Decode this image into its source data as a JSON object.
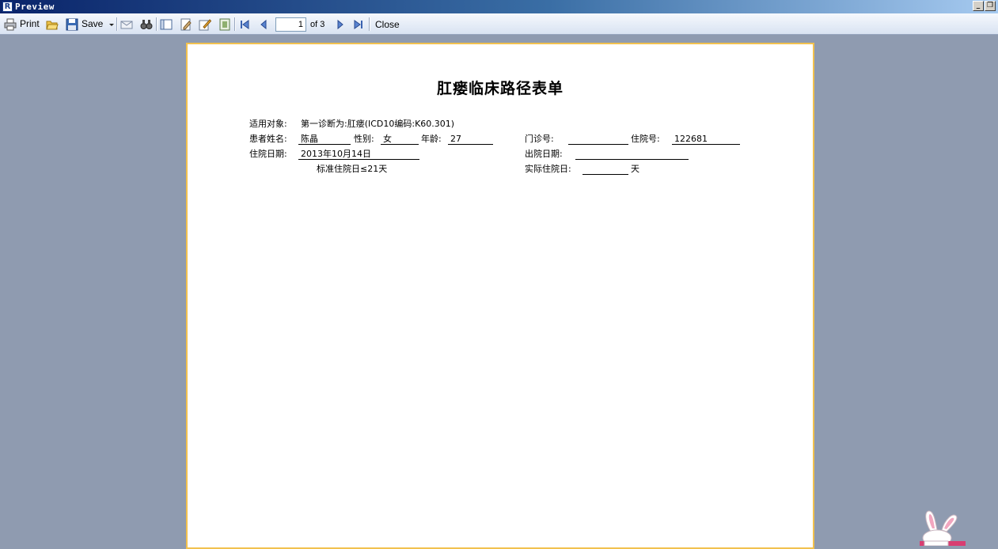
{
  "window": {
    "title": "Preview",
    "app_icon": "R"
  },
  "toolbar": {
    "print_label": "Print",
    "save_label": "Save",
    "page_value": "1",
    "page_of": "of 3",
    "close_label": "Close"
  },
  "document": {
    "title": "肛瘘临床路径表单",
    "applicable_label": "适用对象:",
    "applicable_value": "第一诊断为:肛瘘(ICD10编码:K60.301)",
    "patient_name_label": "患者姓名:",
    "patient_name": "陈晶",
    "sex_label": "性别:",
    "sex": "女",
    "age_label": "年龄:",
    "age": "27",
    "clinic_no_label": "门诊号:",
    "clinic_no": "",
    "inpatient_no_label": "住院号:",
    "inpatient_no": "122681",
    "admit_date_label": "住院日期:",
    "admit_date": "2013年10月14日",
    "discharge_date_label": "出院日期:",
    "discharge_date": "",
    "standard_stay": "标准住院日≤21天",
    "actual_stay_label": "实际住院日:",
    "actual_stay": "",
    "actual_stay_unit": "天"
  },
  "colors": {
    "background": "#8f9bb0",
    "page_border": "#f2c14e",
    "titlebar": "#0a246a"
  }
}
